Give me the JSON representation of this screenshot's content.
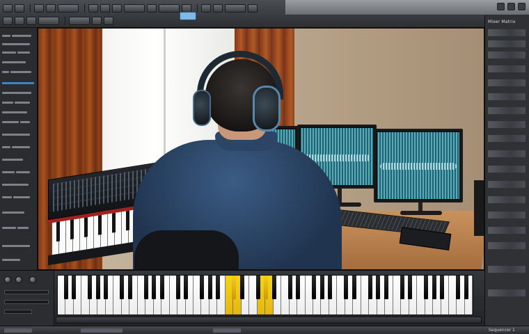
{
  "app": {
    "panel_title": "Mixer Matrix",
    "status_label": "Sequencer 1"
  },
  "toolbar": {
    "icons": [
      "file-icon",
      "save-icon",
      "undo-icon",
      "redo-icon",
      "play-icon",
      "stop-icon",
      "record-icon",
      "loop-icon",
      "metronome-icon",
      "settings-icon"
    ]
  },
  "viewport": {
    "scene": "studio-photo"
  },
  "piano": {
    "white_key_count": 52,
    "active_white_keys": [
      21,
      22,
      25,
      26
    ],
    "active_color": "#f2cb17"
  },
  "colors": {
    "accent": "#3d86c6",
    "display": "#7fb8e6",
    "background": "#1d1f22"
  }
}
